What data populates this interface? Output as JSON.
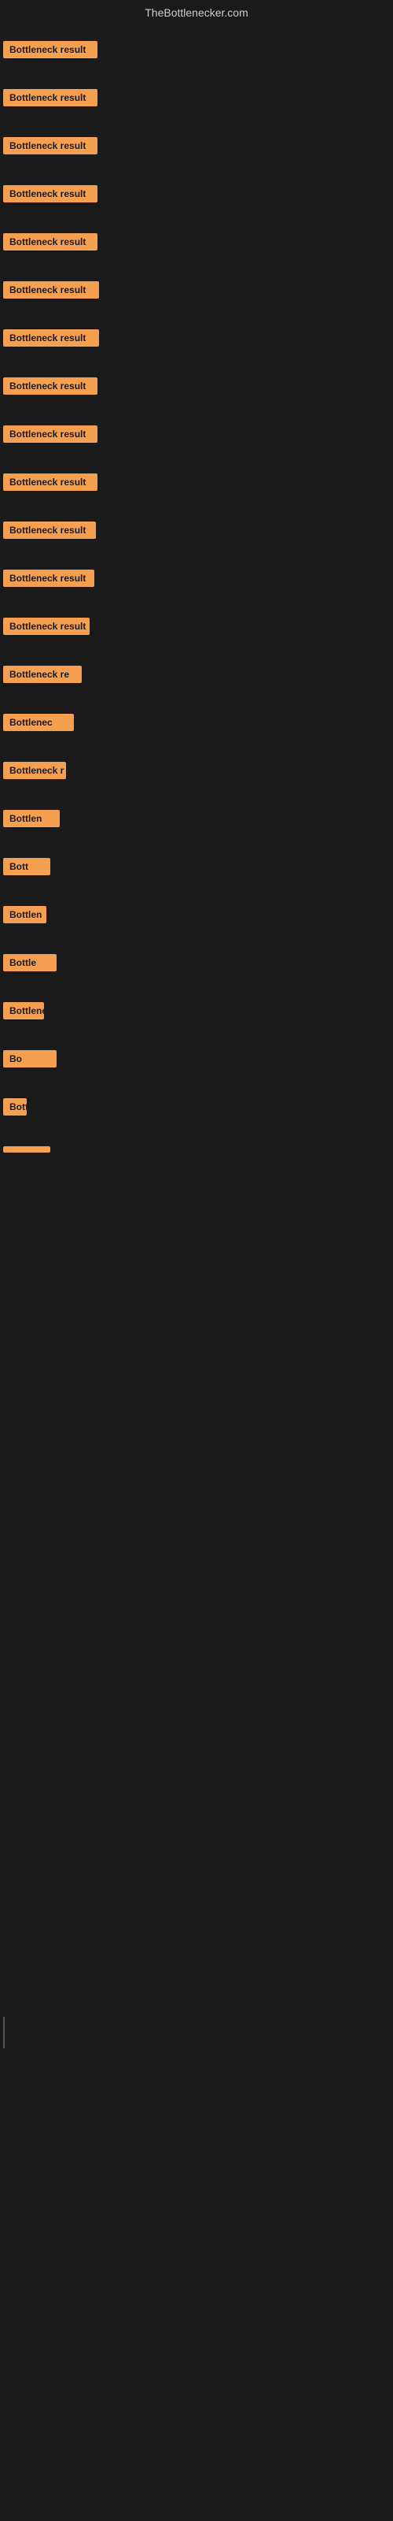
{
  "header": {
    "title": "TheBottlenecker.com"
  },
  "rows": [
    {
      "id": 1,
      "label": "Bottleneck result"
    },
    {
      "id": 2,
      "label": "Bottleneck result"
    },
    {
      "id": 3,
      "label": "Bottleneck result"
    },
    {
      "id": 4,
      "label": "Bottleneck result"
    },
    {
      "id": 5,
      "label": "Bottleneck result"
    },
    {
      "id": 6,
      "label": "Bottleneck result"
    },
    {
      "id": 7,
      "label": "Bottleneck result"
    },
    {
      "id": 8,
      "label": "Bottleneck result"
    },
    {
      "id": 9,
      "label": "Bottleneck result"
    },
    {
      "id": 10,
      "label": "Bottleneck result"
    },
    {
      "id": 11,
      "label": "Bottleneck result"
    },
    {
      "id": 12,
      "label": "Bottleneck result"
    },
    {
      "id": 13,
      "label": "Bottleneck result"
    },
    {
      "id": 14,
      "label": "Bottleneck re"
    },
    {
      "id": 15,
      "label": "Bottlenec"
    },
    {
      "id": 16,
      "label": "Bottleneck r"
    },
    {
      "id": 17,
      "label": "Bottlen"
    },
    {
      "id": 18,
      "label": "Bott"
    },
    {
      "id": 19,
      "label": "Bottlen"
    },
    {
      "id": 20,
      "label": "Bottle"
    },
    {
      "id": 21,
      "label": "Bottlenec"
    },
    {
      "id": 22,
      "label": "Bo"
    },
    {
      "id": 23,
      "label": "Bottler"
    },
    {
      "id": 24,
      "label": ""
    }
  ]
}
